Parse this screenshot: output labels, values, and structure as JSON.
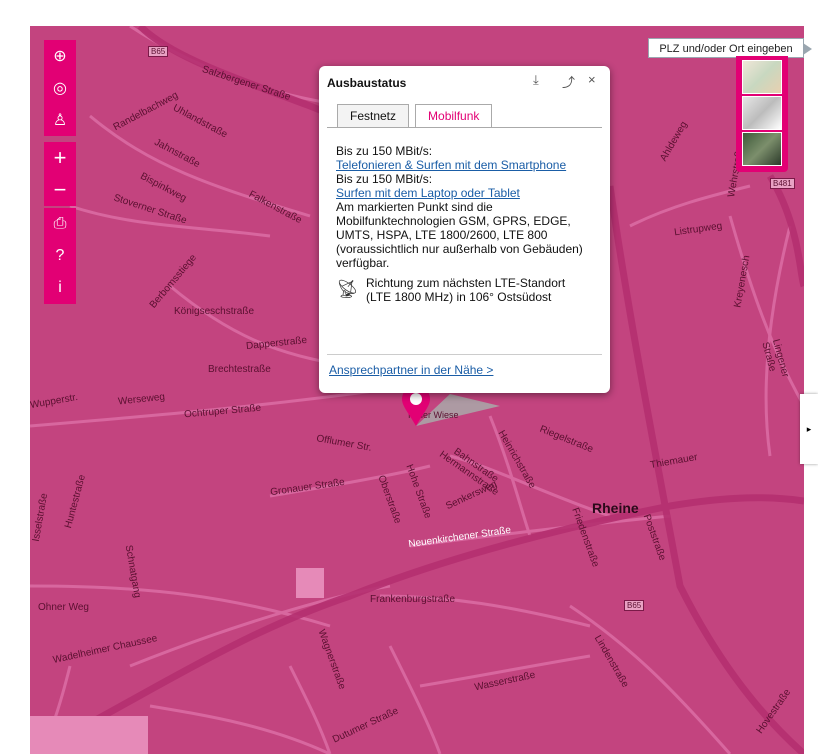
{
  "search": {
    "placeholder": "PLZ und/oder Ort eingeben"
  },
  "toolbar": {
    "locate_icon": "crosshair-icon",
    "gps_icon": "target-icon",
    "pegman_icon": "person-icon",
    "zoom_in": "+",
    "zoom_out": "−",
    "print_icon": "printer-icon",
    "help": "?",
    "info": "i"
  },
  "popup": {
    "title": "Ausbaustatus",
    "tabs": [
      "Festnetz",
      "Mobilfunk"
    ],
    "active_tab": "Mobilfunk",
    "line1": "Bis zu 150 MBit/s:",
    "link1": "Telefonieren & Surfen mit dem Smartphone",
    "line2": "Bis zu 150 MBit/s:",
    "link2": "Surfen mit dem Laptop oder Tablet",
    "text": "Am markierten Punkt sind die Mobilfunktechnologien GSM, GPRS, EDGE, UMTS, HSPA, LTE 1800/2600, LTE 800 (voraussichtlich nur außerhalb von Gebäuden) verfügbar.",
    "direction": "Richtung zum nächsten LTE-Standort (LTE 1800 MHz) in 106° Ostsüdost",
    "footer_link": "Ansprechpartner in der Nähe >",
    "close": "×"
  },
  "map": {
    "city": "Rheine",
    "streets": {
      "salzbergener": "Salzbergener Straße",
      "randelbach": "Randelbachweg",
      "uhland": "Uhlandstraße",
      "jahn": "Jahnstraße",
      "bispink": "Bispinkweg",
      "stoverner": "Stoverner Straße",
      "falken": "Falkenstraße",
      "berbom": "Berbomsstiege",
      "koenigsesch": "Königseschstraße",
      "dapper": "Dapperstraße",
      "brecht": "Brechtestraße",
      "werse": "Werseweg",
      "wupper": "Wupperstr.",
      "ochtruper": "Ochtruper Straße",
      "offlumer": "Offlumer Str.",
      "gronauer": "Gronauer Straße",
      "neuenkirchener": "Neuenkirchener Straße",
      "frankenburg": "Frankenburgstraße",
      "ohner": "Ohner Weg",
      "wadelheimer": "Wadelheimer Chaussee",
      "wasser": "Wasserstraße",
      "linden": "Lindenstraße",
      "wehr": "Wehrstraße",
      "listrup": "Listrupweg",
      "riegel": "Riegelstraße",
      "thiemauer": "Thiemauer",
      "heinrich": "Heinrichstraße",
      "ahldeweg": "Ahldeweg",
      "schnatgang": "Schnatgang",
      "post": "Poststraße",
      "hovestrasse": "Hovestraße",
      "dutumer": "Dutumer Straße",
      "wagner": "Wagnerstraße",
      "huntestrasse": "Huntestraße",
      "issel": "Isselstraße",
      "kreyenesch": "Kreyenesch",
      "lingener": "Lingener Straße",
      "in_der_wiese": "In der Wiese",
      "hohe": "Hohe Straße",
      "oberstrasse": "Oberstraße",
      "hermann": "Hermannstraße",
      "bahnstr": "Bahnstraße",
      "senkers": "Senkersweg",
      "friedens": "Friedenstraße"
    },
    "road_labels": {
      "b65": "B65",
      "b481": "B481"
    }
  },
  "colors": {
    "accent": "#e20074",
    "map_bg": "#c3447f",
    "road": "#d96aa0",
    "link": "#1a5da6"
  }
}
